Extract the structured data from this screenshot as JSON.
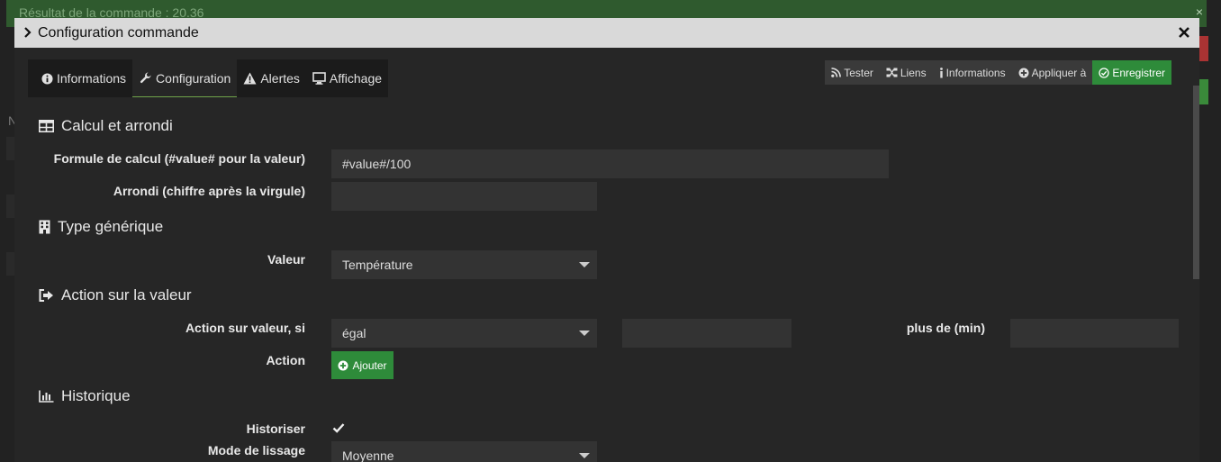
{
  "background": {
    "banner_text": "Résultat de la commande : 20.36",
    "banner_close": "×",
    "side_letter": "N"
  },
  "modal": {
    "title": "Configuration commande",
    "close_glyph": "✕"
  },
  "tabs": [
    {
      "label": "Informations",
      "icon": "info-circle-icon"
    },
    {
      "label": "Configuration",
      "icon": "wrench-icon",
      "active": true
    },
    {
      "label": "Alertes",
      "icon": "warning-triangle-icon"
    },
    {
      "label": "Affichage",
      "icon": "monitor-icon"
    }
  ],
  "actions": [
    {
      "label": "Tester",
      "icon": "rss-icon"
    },
    {
      "label": "Liens",
      "icon": "sitemap-icon"
    },
    {
      "label": "Informations",
      "icon": "info-icon"
    },
    {
      "label": "Appliquer à",
      "icon": "plus-circle-icon"
    },
    {
      "label": "Enregistrer",
      "icon": "check-circle-icon"
    }
  ],
  "sections": {
    "calcul": {
      "title": "Calcul et arrondi",
      "icon": "table-icon"
    },
    "type": {
      "title": "Type générique",
      "icon": "building-icon"
    },
    "action": {
      "title": "Action sur la valeur",
      "icon": "sign-out-icon"
    },
    "historique": {
      "title": "Historique",
      "icon": "bar-chart-icon"
    }
  },
  "form": {
    "formule_label": "Formule de calcul (#value# pour la valeur)",
    "formule_value": "#value#/100",
    "arrondi_label": "Arrondi (chiffre après la virgule)",
    "arrondi_value": "",
    "valeur_label": "Valeur",
    "valeur_selected": "Température",
    "action_si_label": "Action sur valeur, si",
    "action_si_selected": "égal",
    "action_si_value": "",
    "plus_de_label": "plus de (min)",
    "plus_de_value": "",
    "action_label": "Action",
    "ajouter_label": "Ajouter",
    "historiser_label": "Historiser",
    "historiser_checked": true,
    "lissage_label": "Mode de lissage",
    "lissage_selected": "Moyenne"
  },
  "colors": {
    "accent_green": "#2e8b3a",
    "banner_green": "#2f5a2e",
    "tab_active_border": "#6fa34a"
  }
}
